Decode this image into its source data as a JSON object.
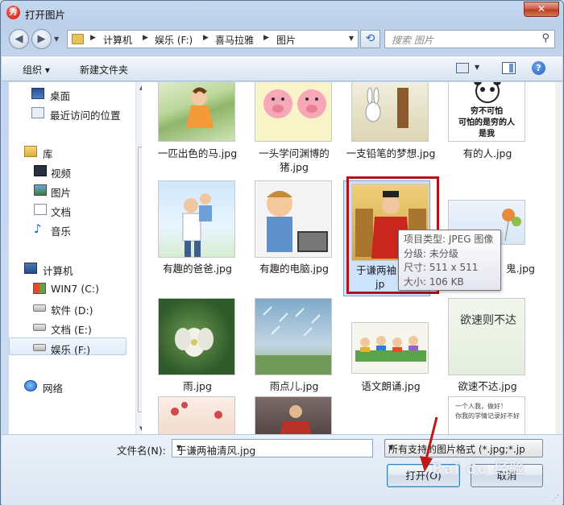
{
  "window": {
    "title": "打开图片",
    "close_glyph": "✕"
  },
  "address": {
    "crumbs": [
      "计算机",
      "娱乐 (F:)",
      "喜马拉雅",
      "图片"
    ],
    "search_placeholder": "搜索 图片"
  },
  "toolbar": {
    "organize": "组织 ▾",
    "new_folder": "新建文件夹"
  },
  "sidebar": {
    "favorites": [
      "桌面",
      "最近访问的位置"
    ],
    "library_header": "库",
    "libraries": [
      "视频",
      "图片",
      "文档",
      "音乐"
    ],
    "computer_header": "计算机",
    "drives": [
      "WIN7 (C:)",
      "软件 (D:)",
      "文档 (E:)",
      "娱乐 (F:)"
    ],
    "network": "网络"
  },
  "files": [
    {
      "name": "一匹出色的马.jpg"
    },
    {
      "name": "一头学问渊博的猪.jpg"
    },
    {
      "name": "一支铅笔的梦想.jpg"
    },
    {
      "name": "有的人.jpg",
      "thumb_text": [
        "穷不可怕",
        "可怕的是穷的人",
        "是我"
      ]
    },
    {
      "name": "有趣的爸爸.jpg"
    },
    {
      "name": "有趣的电脑.jpg"
    },
    {
      "name": "于谦两袖清风.jpg",
      "visible_label": "于谦两袖",
      "visible_label_2": "jp"
    },
    {
      "name": "...鬼.jpg",
      "visible_label": "鬼.jpg"
    },
    {
      "name": "雨.jpg"
    },
    {
      "name": "雨点儿.jpg"
    },
    {
      "name": "语文朗诵.jpg"
    },
    {
      "name": "欲速不达.jpg",
      "thumb_text": [
        "欲速则不达"
      ]
    },
    {
      "name": ""
    },
    {
      "name": ""
    },
    {
      "name": ""
    },
    {
      "name": "",
      "thumb_text": [
        "一个人我，做好！",
        "你我的学情记录好不好"
      ]
    }
  ],
  "tooltip": {
    "type": "项目类型: JPEG 图像",
    "rating": "分级: 未分级",
    "size_dims": "尺寸: 511 x 511",
    "file_size": "大小: 106 KB"
  },
  "bottom": {
    "filename_label": "文件名(N):",
    "filename_value": "于谦两袖清风.jpg",
    "filter_value": "所有支持的图片格式 (*.jpg;*.jp",
    "open_button": "打开(O)",
    "cancel_button": "取消"
  },
  "watermark": "Bai du 经验",
  "colors": {
    "highlight_box": "#b01218",
    "selection": "#cde2fb",
    "window_chrome": "#c6d8ee"
  }
}
